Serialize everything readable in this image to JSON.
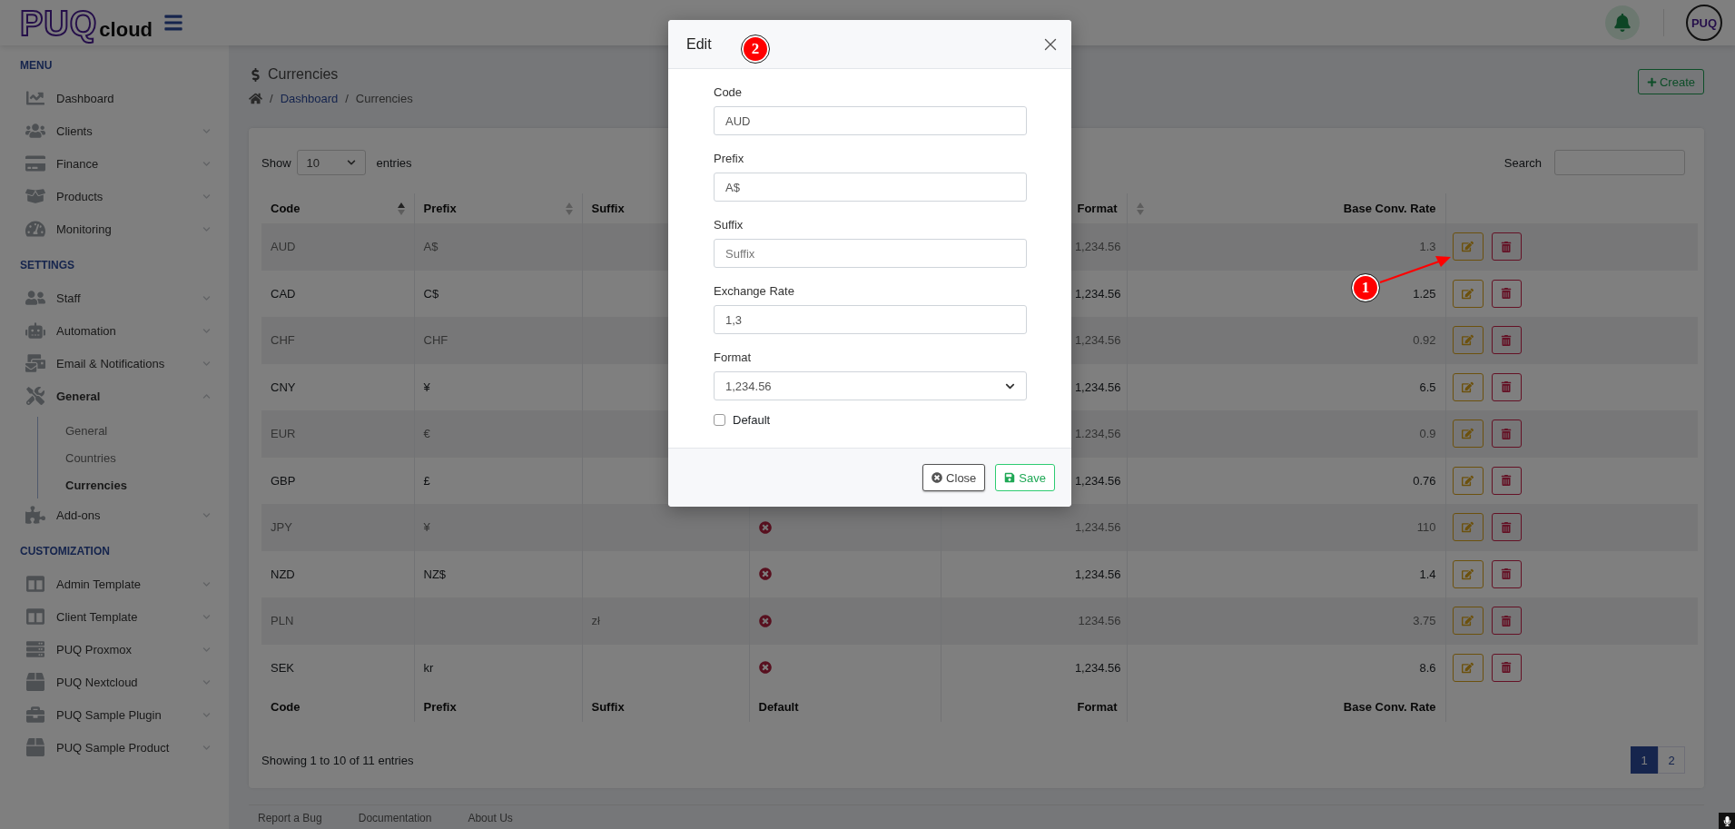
{
  "header": {
    "logo_main": "PUQ",
    "logo_sub": "cloud",
    "avatar": "PUQ"
  },
  "sidebar": {
    "sections": [
      {
        "title": "MENU",
        "items": [
          {
            "label": "Dashboard"
          },
          {
            "label": "Clients",
            "expanded": false
          },
          {
            "label": "Finance",
            "expanded": false
          },
          {
            "label": "Products",
            "expanded": false
          },
          {
            "label": "Monitoring",
            "expanded": false
          }
        ]
      },
      {
        "title": "SETTINGS",
        "items": [
          {
            "label": "Staff",
            "expanded": false
          },
          {
            "label": "Automation",
            "expanded": false
          },
          {
            "label": "Email & Notifications",
            "expanded": false
          },
          {
            "label": "General",
            "expanded": true,
            "selected": true,
            "children": [
              {
                "label": "General",
                "selected": false
              },
              {
                "label": "Countries",
                "selected": false
              },
              {
                "label": "Currencies",
                "selected": true
              }
            ]
          },
          {
            "label": "Add-ons",
            "expanded": false
          }
        ]
      },
      {
        "title": "CUSTOMIZATION",
        "items": [
          {
            "label": "Admin Template",
            "expanded": false
          },
          {
            "label": "Client Template",
            "expanded": false
          },
          {
            "label": "PUQ Proxmox",
            "expanded": false
          },
          {
            "label": "PUQ Nextcloud",
            "expanded": false
          },
          {
            "label": "PUQ Sample Plugin",
            "expanded": false
          },
          {
            "label": "PUQ Sample Product",
            "expanded": false
          }
        ]
      }
    ]
  },
  "page": {
    "title": "Currencies",
    "breadcrumb": {
      "separator": "/",
      "items": [
        "Dashboard",
        "Currencies"
      ]
    },
    "create_button": "Create"
  },
  "table": {
    "show_label": "Show",
    "page_size": "10",
    "entries_label": "entries",
    "search_label": "Search",
    "columns": [
      {
        "label": "Code",
        "sorted": true
      },
      {
        "label": "Prefix",
        "sorted": false
      },
      {
        "label": "Suffix"
      },
      null,
      {
        "label": "Format"
      },
      {
        "label": "Base Conv. Rate",
        "sorted": false
      }
    ],
    "rows": [
      {
        "code": "AUD",
        "prefix": "A$",
        "suffix": "",
        "format": "1,234.56",
        "rate": "1.3"
      },
      {
        "code": "CAD",
        "prefix": "C$",
        "suffix": "",
        "format": "1,234.56",
        "rate": "1.25"
      },
      {
        "code": "CHF",
        "prefix": "CHF",
        "suffix": "",
        "format": "1,234.56",
        "rate": "0.92"
      },
      {
        "code": "CNY",
        "prefix": "¥",
        "suffix": "",
        "format": "1,234.56",
        "rate": "6.5"
      },
      {
        "code": "EUR",
        "prefix": "€",
        "suffix": "",
        "format": "1.234,56",
        "rate": "0.9"
      },
      {
        "code": "GBP",
        "prefix": "£",
        "suffix": "",
        "format": "1,234.56",
        "rate": "0.76"
      },
      {
        "code": "JPY",
        "prefix": "¥",
        "suffix": "",
        "default": false,
        "format": "1,234.56",
        "rate": "110"
      },
      {
        "code": "NZD",
        "prefix": "NZ$",
        "suffix": "",
        "default": false,
        "format": "1,234.56",
        "rate": "1.4"
      },
      {
        "code": "PLN",
        "prefix": "",
        "suffix": "zł",
        "default": false,
        "format": "1234.56",
        "rate": "3.75"
      },
      {
        "code": "SEK",
        "prefix": "kr",
        "suffix": "",
        "default": false,
        "format": "1,234.56",
        "rate": "8.6"
      }
    ],
    "footer_columns": [
      "Code",
      "Prefix",
      "Suffix",
      "Default",
      "Format",
      "Base Conv. Rate"
    ],
    "info": "Showing 1 to 10 of 11 entries",
    "pagination": [
      {
        "label": "1",
        "selected": true
      },
      {
        "label": "2",
        "selected": false
      }
    ]
  },
  "modal": {
    "title": "Edit",
    "fields": [
      {
        "kind": "text",
        "label": "Code",
        "value": "AUD"
      },
      {
        "kind": "text",
        "label": "Prefix",
        "value": "A$"
      },
      {
        "kind": "text",
        "label": "Suffix",
        "placeholder": "Suffix"
      },
      {
        "kind": "text",
        "label": "Exchange Rate",
        "value": "1,3"
      },
      {
        "kind": "select",
        "label": "Format",
        "value": "1,234.56"
      },
      {
        "kind": "checkbox",
        "label": "Default",
        "checked": false
      }
    ],
    "buttons": [
      {
        "kind": "close",
        "label": "Close"
      },
      {
        "kind": "save",
        "label": "Save"
      }
    ]
  },
  "annotations": [
    {
      "label": "1"
    },
    {
      "label": "2"
    }
  ],
  "footer_links": [
    "Report a Bug",
    "Documentation",
    "About Us"
  ]
}
